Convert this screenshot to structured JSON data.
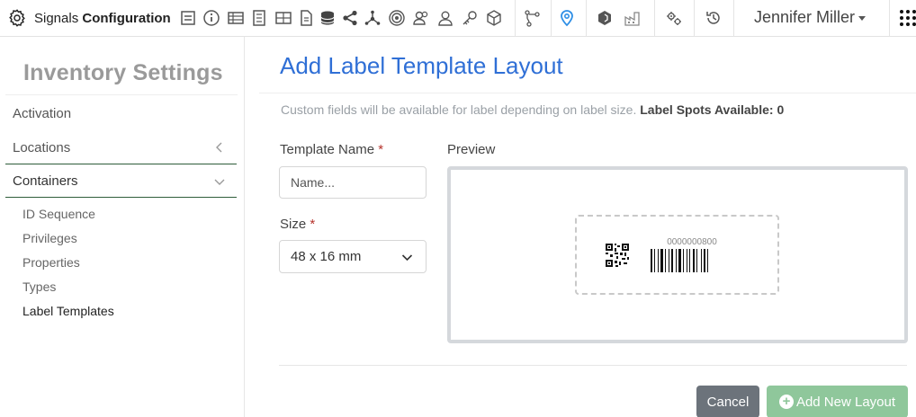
{
  "app": {
    "name_light": "Signals",
    "name_bold": "Configuration"
  },
  "toolbar_icons": [
    "form-icon",
    "info-icon",
    "table-icon",
    "document-list-icon",
    "grid-table-icon",
    "file-icon",
    "database-icon",
    "share-icon",
    "network-icon",
    "target-icon",
    "users-icon",
    "user-icon",
    "key-icon",
    "cube-icon",
    "workflow-icon",
    "map-pin-icon",
    "hexagon-icon",
    "factory-icon",
    "gears-icon",
    "history-icon"
  ],
  "user": {
    "name": "Jennifer Miller"
  },
  "sidebar": {
    "title": "Inventory Settings",
    "items": [
      {
        "label": "Activation"
      },
      {
        "label": "Locations"
      },
      {
        "label": "Containers"
      }
    ],
    "sub_items": [
      "ID Sequence",
      "Privileges",
      "Properties",
      "Types",
      "Label Templates"
    ]
  },
  "main": {
    "title": "Add Label Template Layout",
    "notice": "Custom fields will be available for label depending on label size.",
    "spots_label": "Label Spots Available: 0",
    "template_name_label": "Template Name",
    "template_name_placeholder": "Name...",
    "required_mark": "*",
    "size_label": "Size",
    "size_value": "48 x 16 mm",
    "preview_label": "Preview",
    "barcode_number": "0000000800"
  },
  "buttons": {
    "cancel": "Cancel",
    "add": "Add New Layout"
  },
  "colors": {
    "title_blue": "#2f6fd6",
    "map_pin_blue": "#2f8fe6",
    "add_button": "#8fc79b",
    "cancel_button": "#6c737b"
  }
}
